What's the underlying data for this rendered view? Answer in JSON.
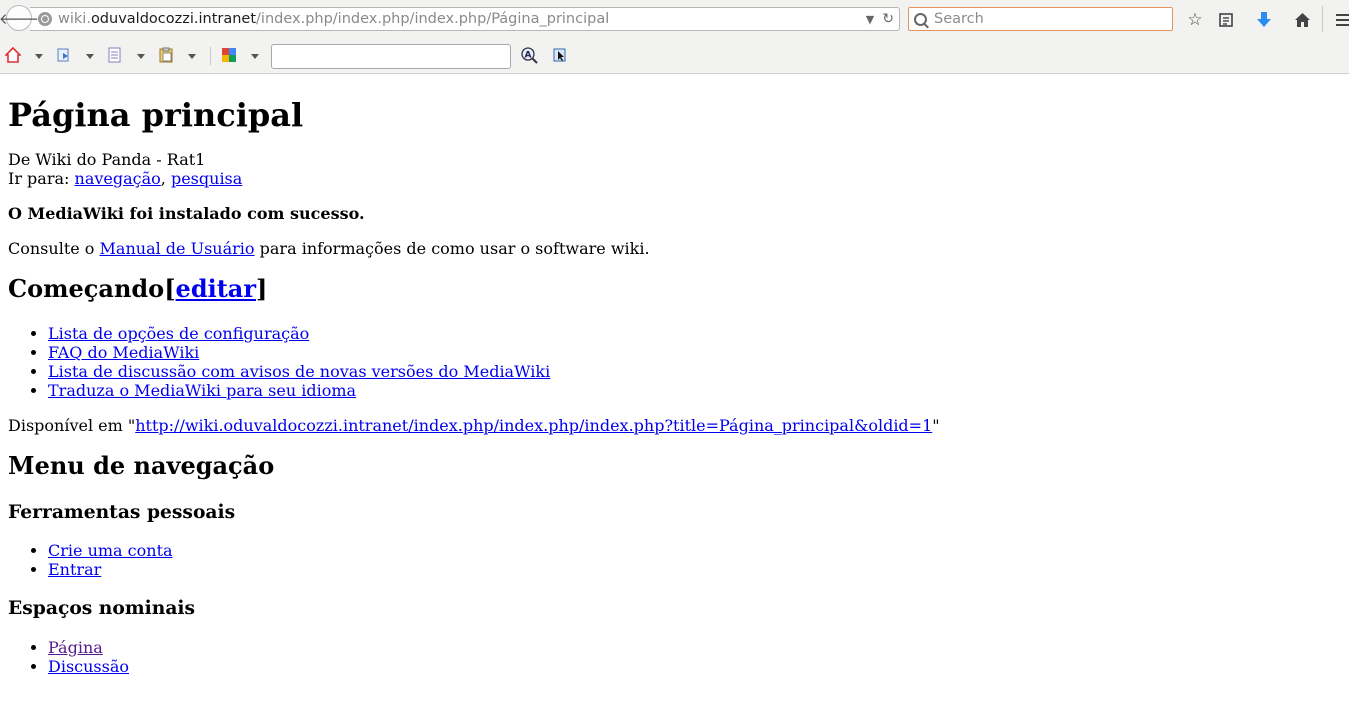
{
  "browser": {
    "url": {
      "prefix": "wiki.",
      "domain": "oduvaldocozzi.intranet",
      "path": "/index.php/index.php/index.php/Página_principal"
    },
    "search_placeholder": "Search",
    "toolbar_input_value": ""
  },
  "page": {
    "title": "Página principal",
    "from_line": "De Wiki do Panda - Rat1",
    "jump_to_label": "Ir para:",
    "jump_nav": "navegação",
    "jump_sep": ",",
    "jump_search": "pesquisa",
    "success_msg": "O MediaWiki foi instalado com sucesso.",
    "consult_pre": "Consulte o",
    "consult_link": "Manual de Usuário",
    "consult_post": "para informações de como usar o software wiki.",
    "section_start": {
      "title": "Começando",
      "edit_open": "[",
      "edit_label": "editar",
      "edit_close": "]"
    },
    "start_links": [
      "Lista de opções de configuração",
      "FAQ do MediaWiki",
      "Lista de discussão com avisos de novas versões do MediaWiki",
      "Traduza o MediaWiki para seu idioma"
    ],
    "available_pre": "Disponível em \"",
    "available_link": "http://wiki.oduvaldocozzi.intranet/index.php/index.php/index.php?title=Página_principal&oldid=1",
    "available_post": "\"",
    "nav_menu_title": "Menu de navegação",
    "personal_tools_title": "Ferramentas pessoais",
    "personal_tools": [
      "Crie uma conta",
      "Entrar"
    ],
    "namespaces_title": "Espaços nominais",
    "namespaces": [
      "Página",
      "Discussão"
    ]
  }
}
